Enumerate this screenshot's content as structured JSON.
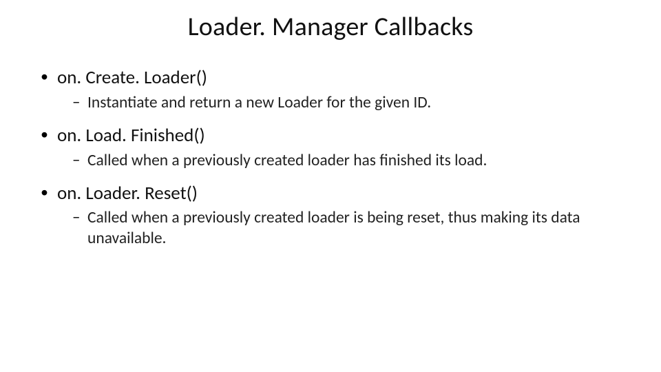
{
  "title": "Loader. Manager Callbacks",
  "bullets": [
    {
      "heading": "on. Create. Loader()",
      "sub": "Instantiate and return a new Loader for the given ID."
    },
    {
      "heading": "on. Load. Finished()",
      "sub": "Called when a previously created loader has finished its load."
    },
    {
      "heading": "on. Loader. Reset()",
      "sub": "Called when a previously created loader is being reset, thus making its data unavailable."
    }
  ]
}
